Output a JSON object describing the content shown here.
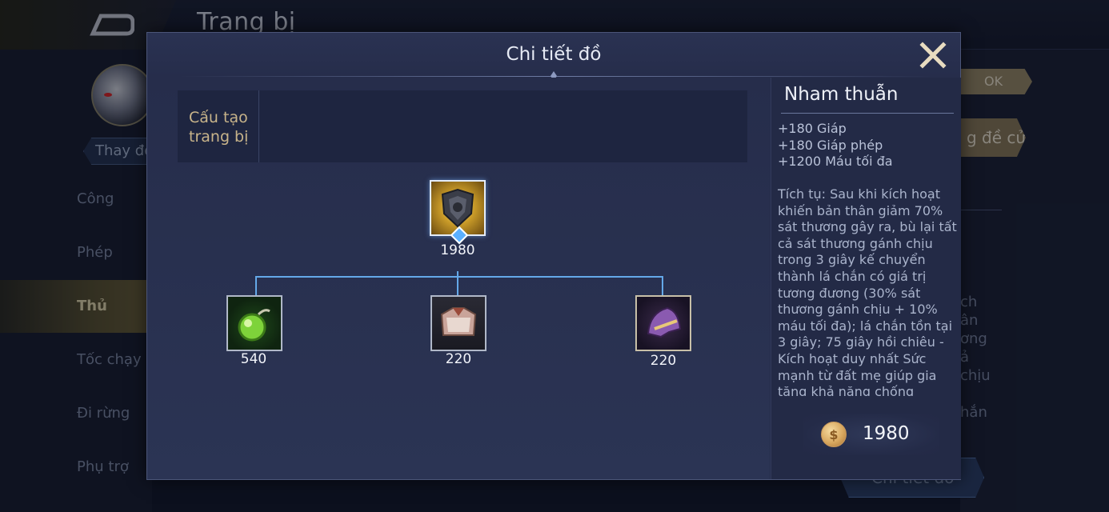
{
  "background": {
    "title": "Trang bị",
    "change_button": "Thay đổi",
    "ok_button": "OK",
    "recommend_button": "g đề cử",
    "detail_button": "Chi tiết đồ",
    "menu": [
      {
        "label": "Công",
        "active": false
      },
      {
        "label": "Phép",
        "active": false
      },
      {
        "label": "Thủ",
        "active": true
      },
      {
        "label": "Tốc chạy",
        "active": false
      },
      {
        "label": "Đi rừng",
        "active": false
      },
      {
        "label": "Phụ trợ",
        "active": false
      }
    ],
    "right_fragments": "ch\nân\nơng\nả\nchịu",
    "right_fragment2": "hắn"
  },
  "modal": {
    "title": "Chi tiết đồ",
    "close_icon": "close-icon",
    "build_label": "Cấu tạo trang bị",
    "tree": {
      "root": {
        "name": "Nham thuẫn",
        "price": "1980",
        "icon": "stone-shield-icon"
      },
      "children": [
        {
          "price": "540",
          "icon": "green-potion-orb-icon"
        },
        {
          "price": "220",
          "icon": "leather-armor-icon"
        },
        {
          "price": "220",
          "icon": "purple-helmet-icon"
        }
      ]
    },
    "info": {
      "name": "Nham thuẫn",
      "stats": [
        "+180 Giáp",
        "+180 Giáp phép",
        "+1200 Máu tối đa"
      ],
      "description": "Tích tụ: Sau khi kích hoạt khiến bản thân giảm 70% sát thương gây ra, bù lại tất cả sát thương gánh chịu trong 3 giây kế chuyển thành lá chắn có giá trị tương đương (30% sát thương gánh chịu + 10% máu tối đa); lá chắn tồn tại 3 giây; 75 giây hồi chiêu - Kích hoạt duy nhất Sức mạnh từ đất mẹ giúp gia tăng khả năng chống",
      "price": "1980",
      "currency_icon": "gold-coin-icon"
    }
  }
}
